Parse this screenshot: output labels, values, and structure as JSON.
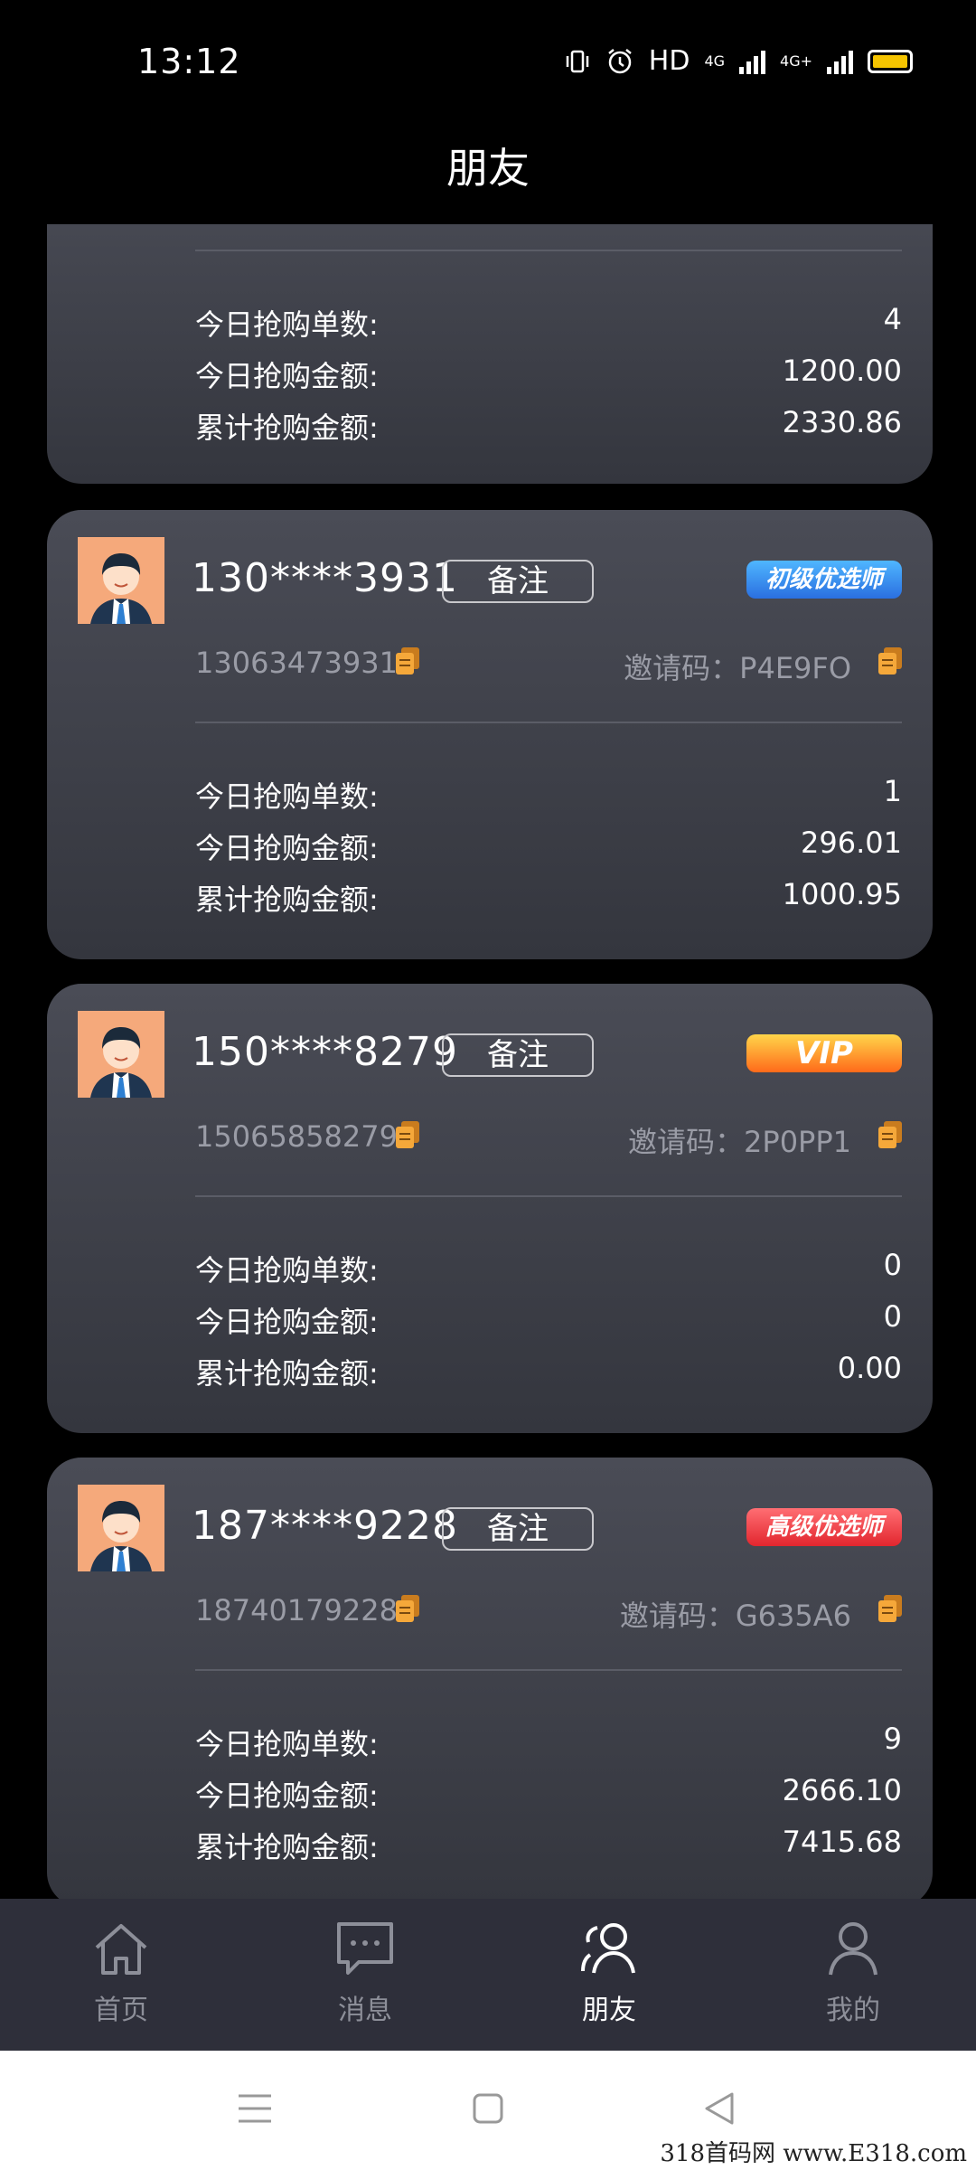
{
  "status_bar": {
    "time": "13:12",
    "network_label": "HD",
    "net1": "4G",
    "net2": "4G+"
  },
  "header": {
    "title": "朋友"
  },
  "labels": {
    "orders_today": "今日抢购单数:",
    "amount_today": "今日抢购金额:",
    "amount_total": "累计抢购金额:",
    "note_button": "备注",
    "invite_prefix": "邀请码："
  },
  "cards": [
    {
      "orders_today": "4",
      "amount_today": "1200.00",
      "amount_total": "2330.86"
    },
    {
      "phone_masked": "130****3931",
      "phone_full": "13063473931",
      "invite_code": "P4E9FO",
      "badge": "初级优选师",
      "badge_color": "#2a6fe0",
      "orders_today": "1",
      "amount_today": "296.01",
      "amount_total": "1000.95"
    },
    {
      "phone_masked": "150****8279",
      "phone_full": "15065858279",
      "invite_code": "2P0PP1",
      "badge": "VIP",
      "badge_color": "#ff6a1a",
      "orders_today": "0",
      "amount_today": "0",
      "amount_total": "0.00"
    },
    {
      "phone_masked": "187****9228",
      "phone_full": "18740179228",
      "invite_code": "G635A6",
      "badge": "高级优选师",
      "badge_color": "#e2262e",
      "orders_today": "9",
      "amount_today": "2666.10",
      "amount_total": "7415.68"
    }
  ],
  "bottom_nav": [
    {
      "label": "首页",
      "icon": "home-icon",
      "active": false
    },
    {
      "label": "消息",
      "icon": "message-icon",
      "active": false
    },
    {
      "label": "朋友",
      "icon": "friends-icon",
      "active": true
    },
    {
      "label": "我的",
      "icon": "profile-icon",
      "active": false
    }
  ],
  "watermark": "318首码网 www.E318.com"
}
